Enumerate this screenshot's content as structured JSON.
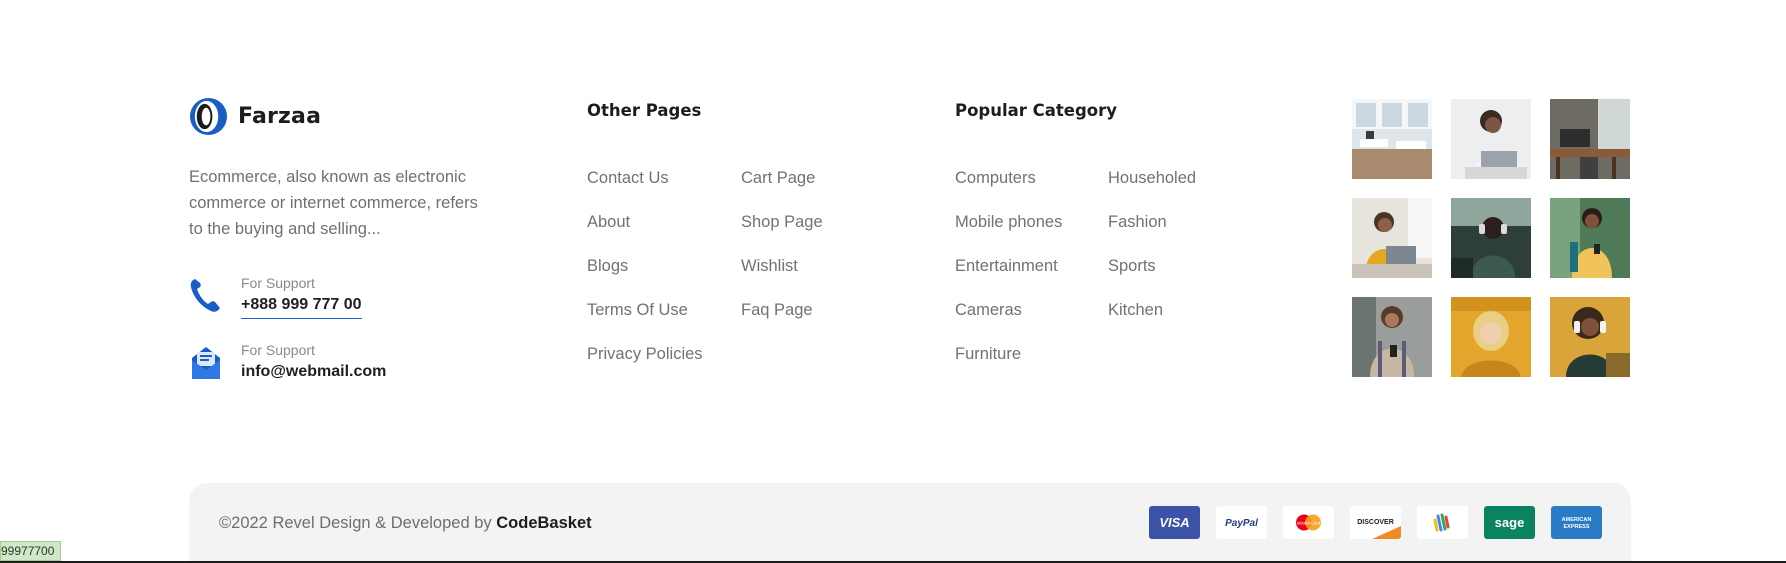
{
  "brand": {
    "name": "Farzaa",
    "description": "Ecommerce, also known as electronic commerce or internet commerce, refers to the buying and selling...",
    "accent_color": "#1a5dc6"
  },
  "contacts": [
    {
      "label": "For Support",
      "value": "+888 999 777 00",
      "icon": "phone-icon"
    },
    {
      "label": "For Support",
      "value": "info@webmail.com",
      "icon": "mail-icon"
    }
  ],
  "other_pages": {
    "title": "Other Pages",
    "col1": [
      "Contact Us",
      "About",
      "Blogs",
      "Terms Of Use",
      "Privacy Policies"
    ],
    "col2": [
      "Cart Page",
      "Shop Page",
      "Wishlist",
      "Faq Page"
    ]
  },
  "popular_category": {
    "title": "Popular Category",
    "col1": [
      "Computers",
      "Mobile phones",
      "Entertainment",
      "Cameras",
      "Furniture"
    ],
    "col2": [
      "Householed",
      "Fashion",
      "Sports",
      "Kitchen"
    ]
  },
  "gallery": [
    "office-photo",
    "woman-laptop-photo",
    "desk-photo",
    "woman-laptop-yellow-photo",
    "man-headphones-photo",
    "man-phone-backpack-photo",
    "woman-phone-photo",
    "woman-yellow-pillow-photo",
    "woman-headphones-photo"
  ],
  "footer": {
    "copyright_prefix": "©2022 Revel Design & Developed by ",
    "copyright_brand": "CodeBasket",
    "payments": [
      {
        "name": "VISA",
        "icon": "visa-icon"
      },
      {
        "name": "PayPal",
        "icon": "paypal-icon"
      },
      {
        "name": "MasterCard",
        "icon": "mastercard-icon"
      },
      {
        "name": "DISCOVER",
        "icon": "discover-icon"
      },
      {
        "name": "Google Wallet",
        "icon": "google-wallet-icon"
      },
      {
        "name": "sage",
        "icon": "sage-icon"
      },
      {
        "name": "AMERICAN EXPRESS",
        "icon": "amex-icon"
      }
    ]
  },
  "status_chip": "99977700"
}
